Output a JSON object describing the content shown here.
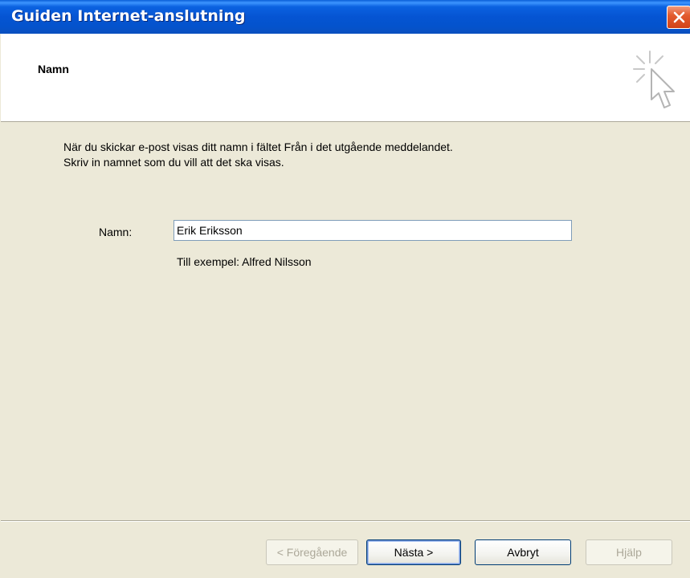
{
  "window": {
    "title": "Guiden Internet-anslutning"
  },
  "header": {
    "heading": "Namn",
    "icon": "wizard-cursor-sparkle-icon"
  },
  "content": {
    "description_line1": "När du skickar e-post visas ditt namn i fältet Från i det utgående meddelandet.",
    "description_line2": "Skriv in namnet som du vill att det ska visas.",
    "name_label": "Namn:",
    "name_value": "Erik Eriksson",
    "example": "Till exempel: Alfred Nilsson"
  },
  "buttons": {
    "back": "< Föregående",
    "next": "Nästa >",
    "cancel": "Avbryt",
    "help": "Hjälp"
  },
  "colors": {
    "titlebar": "#0554d3",
    "dialog_bg": "#ece9d8",
    "close": "#e35c2f"
  }
}
